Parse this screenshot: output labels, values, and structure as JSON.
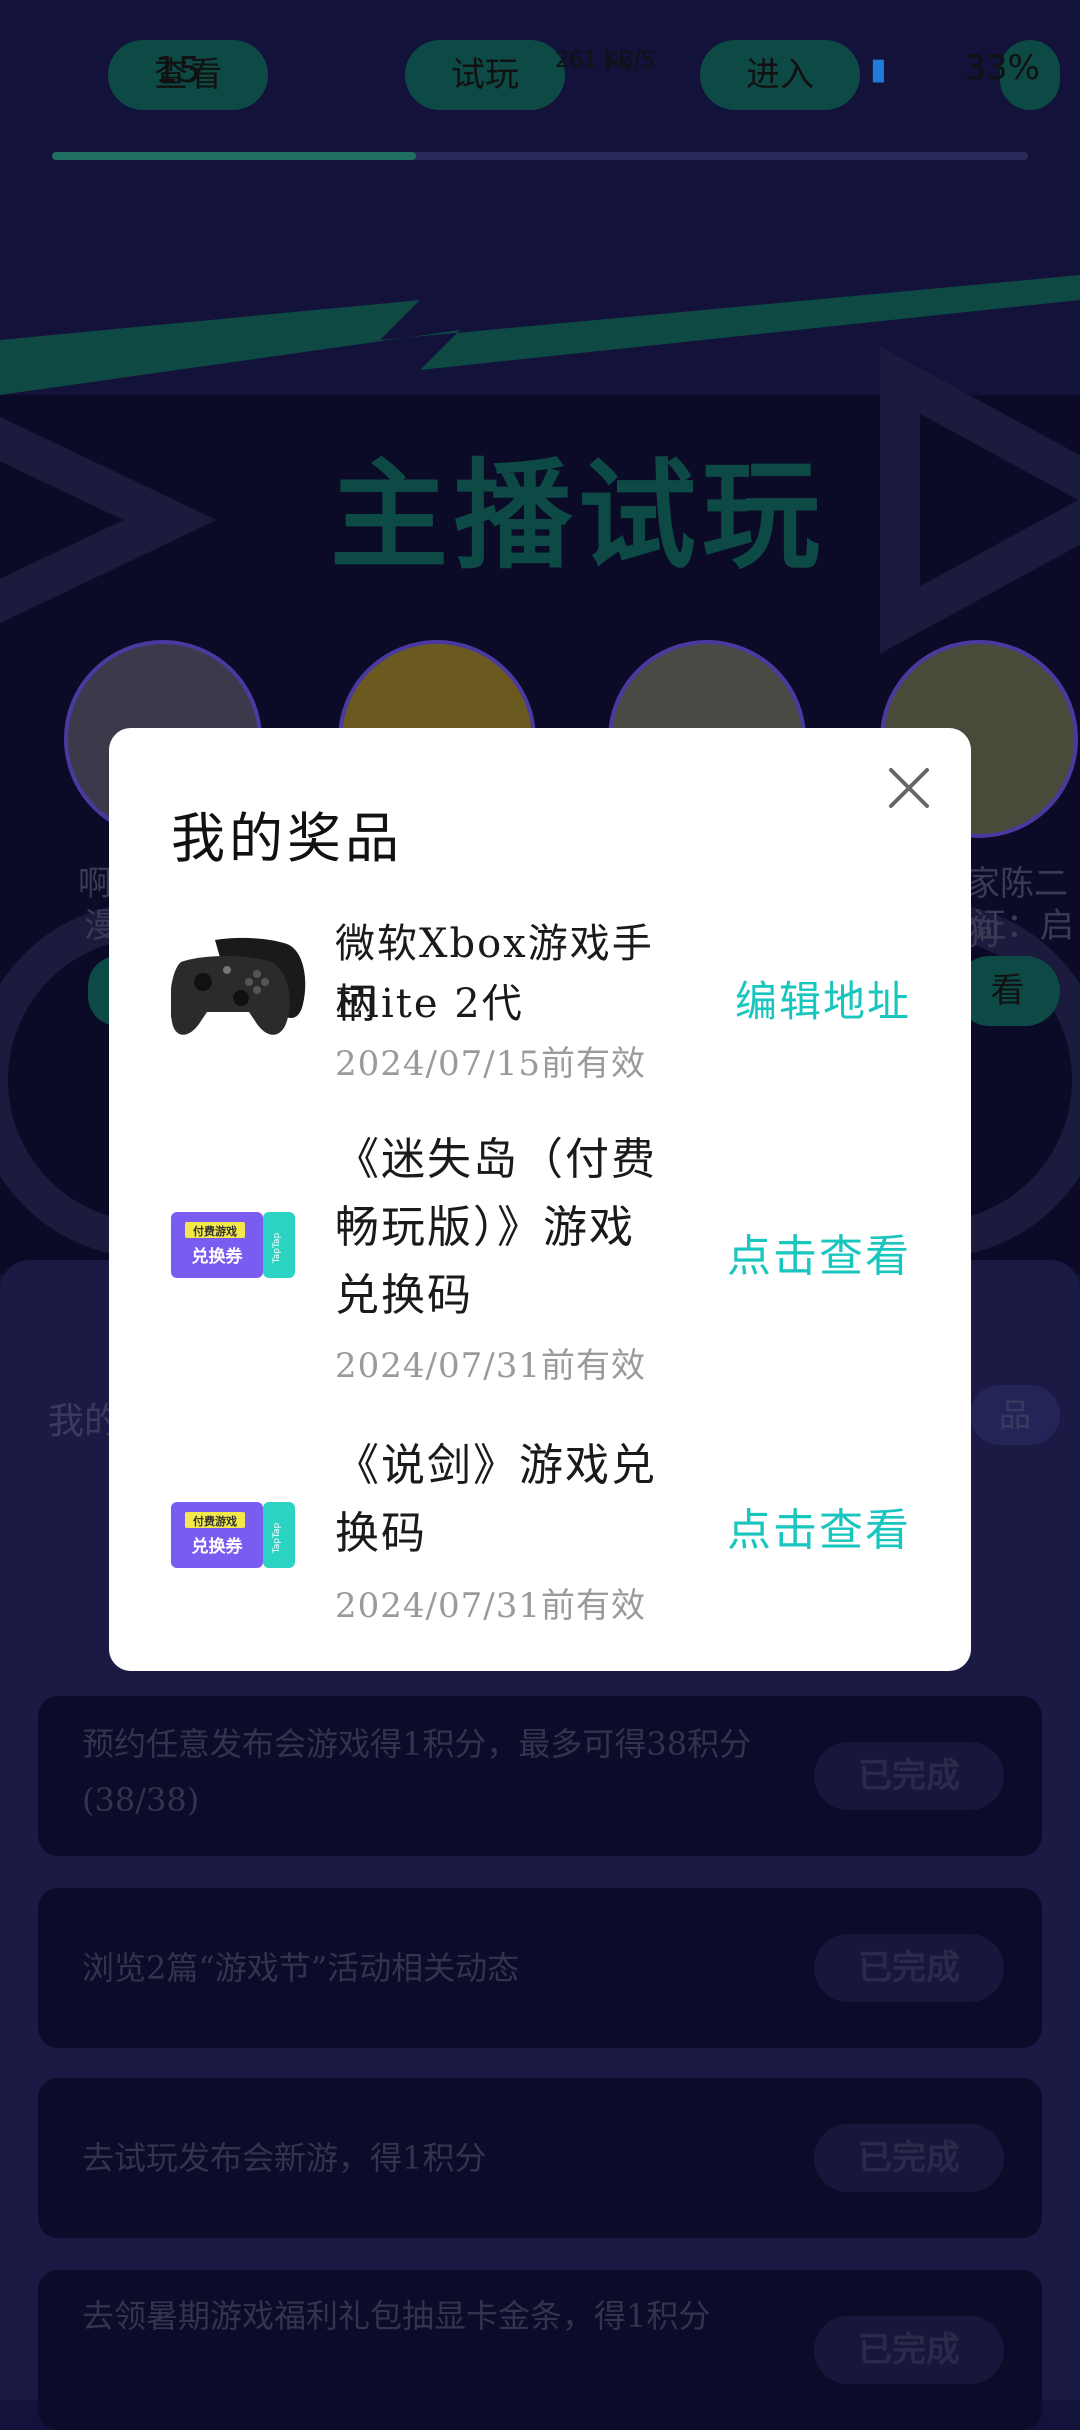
{
  "status_bar": {
    "time": "15",
    "net_speed": "261 KB/S",
    "battery": "33%"
  },
  "top_chips": [
    "查看",
    "试玩",
    "进入"
  ],
  "banner": {
    "title": "主播试玩"
  },
  "streamers": [
    {
      "name": "啊"
    },
    {
      "name": ""
    },
    {
      "name": ""
    },
    {
      "name": "家陈二狗"
    }
  ],
  "streamer_subtitles": [
    "漫",
    "证：启程"
  ],
  "streamer_action": "看",
  "lower": {
    "my_label": "我的",
    "my_prize_chip": "品"
  },
  "tasks": [
    {
      "text": "预约任意发布会游戏得1积分，最多可得38积分(38/38)",
      "button": "已完成"
    },
    {
      "text": "浏览2篇“游戏节”活动相关动态",
      "button": "已完成"
    },
    {
      "text": "去试玩发布会新游，得1积分",
      "button": "已完成"
    },
    {
      "text": "去领暑期游戏福利礼包抽显卡金条，得1积分",
      "button": "已完成"
    }
  ],
  "modal": {
    "title": "我的奖品",
    "close_icon": "close-icon",
    "prizes": [
      {
        "icon": "gamepad-image",
        "name_line1": "微软Xbox游戏手柄",
        "name_line2": "Elite 2代",
        "valid_until": "2024/07/15前有效",
        "action": "编辑地址"
      },
      {
        "icon": "voucher-image",
        "name_line1": "《迷失岛（付费",
        "name_line2": "畅玩版）》游戏",
        "name_line3": "兑换码",
        "valid_until": "2024/07/31前有效",
        "action": "点击查看"
      },
      {
        "icon": "voucher-image",
        "name_line1": "《说剑》游戏兑",
        "name_line2": "换码",
        "valid_until": "2024/07/31前有效",
        "action": "点击查看"
      }
    ],
    "voucher_text_top": "付费游戏",
    "voucher_text_main": "兑换券",
    "voucher_brand": "TapTap"
  },
  "colors": {
    "accent": "#19c6bd",
    "background": "#12123a"
  }
}
